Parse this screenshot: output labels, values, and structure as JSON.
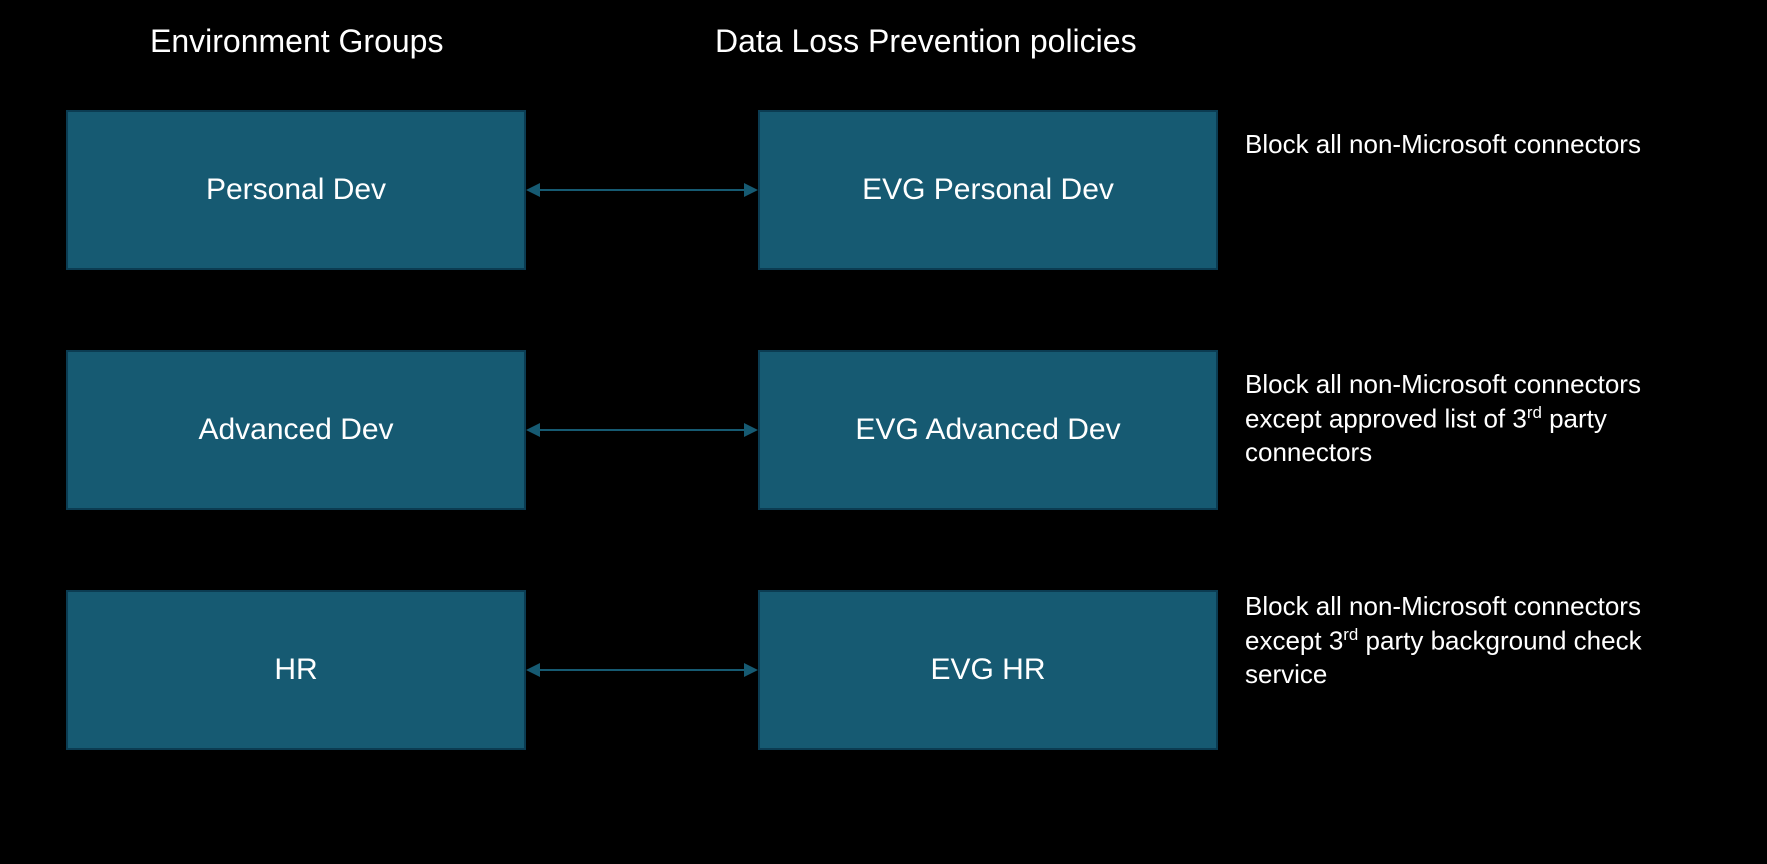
{
  "headers": {
    "left": "Environment Groups",
    "right": "Data Loss Prevention policies"
  },
  "rows": [
    {
      "env_group": "Personal Dev",
      "policy": "EVG Personal Dev",
      "description_html": "Block all non-Microsoft connectors"
    },
    {
      "env_group": "Advanced Dev",
      "policy": "EVG Advanced Dev",
      "description_html": "Block all non-Microsoft connectors except approved list of 3<sup>rd</sup> party connectors"
    },
    {
      "env_group": "HR",
      "policy": "EVG HR",
      "description_html": "Block all non-Microsoft connectors except 3<sup>rd</sup> party background check service"
    }
  ]
}
